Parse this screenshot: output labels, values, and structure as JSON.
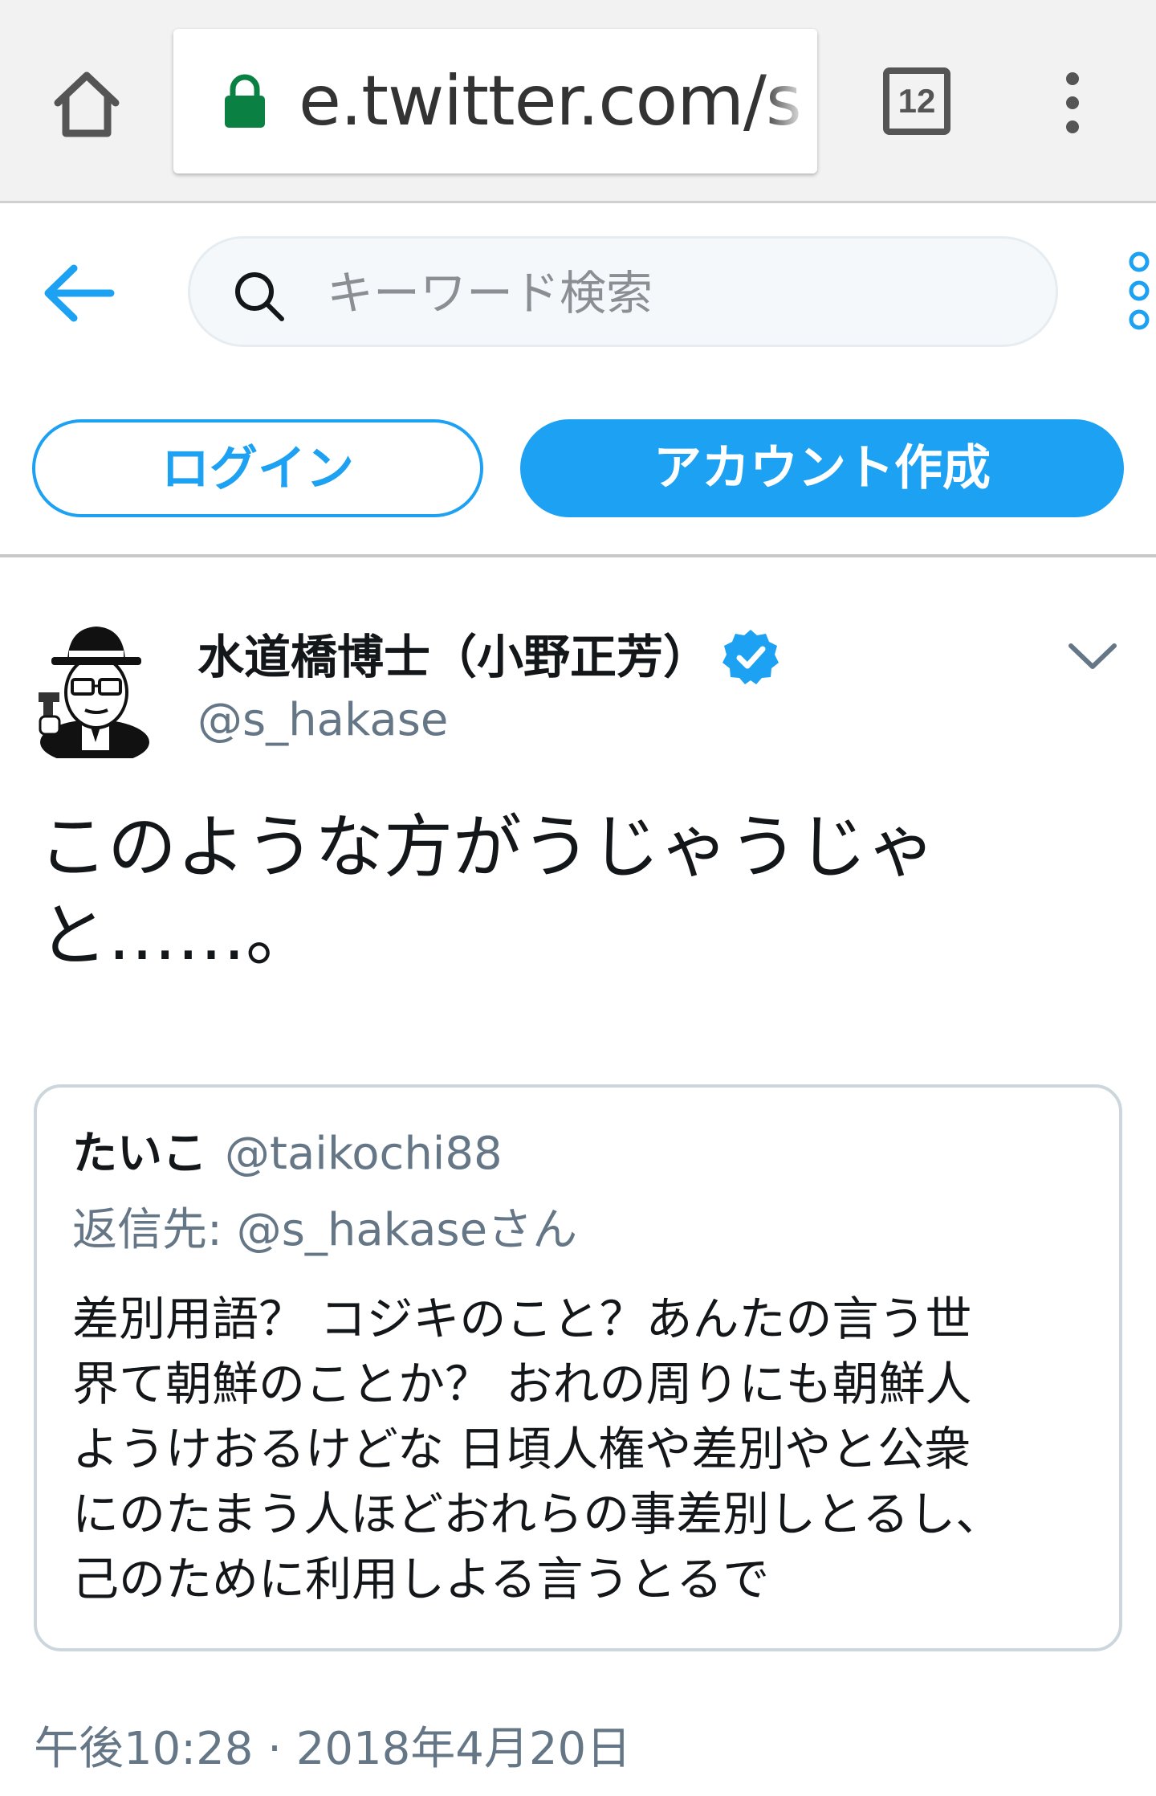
{
  "browser": {
    "url_text": "e.twitter.com/s",
    "tab_count": "12",
    "icons": {
      "home": "home-icon",
      "lock": "lock-icon",
      "menu": "overflow-menu-icon"
    }
  },
  "header": {
    "search_placeholder": "キーワード検索",
    "login_label": "ログイン",
    "signup_label": "アカウント作成"
  },
  "colors": {
    "accent": "#1da1f2",
    "text": "#14171a",
    "muted": "#657786",
    "lock_green": "#0b8043"
  },
  "tweet": {
    "display_name": "水道橋博士（小野正芳）",
    "verified": true,
    "handle": "@s_hakase",
    "text_lines": [
      "このような方がうじゃうじゃ",
      "と……。"
    ],
    "timestamp": "午後10:28 · 2018年4月20日",
    "quoted": {
      "name": "たいこ",
      "handle": "@taikochi88",
      "reply_prefix": "返信先:",
      "reply_handle": "@s_hakaseさん",
      "body_lines": [
        "差別用語？ コジキのこと？あんたの言う世",
        "界て朝鮮のことか？ おれの周りにも朝鮮人",
        "ようけおるけどな 日頃人権や差別やと公衆",
        "にのたまう人ほどおれらの事差別しとるし、",
        "己のために利用しよる言うとるで"
      ]
    }
  }
}
